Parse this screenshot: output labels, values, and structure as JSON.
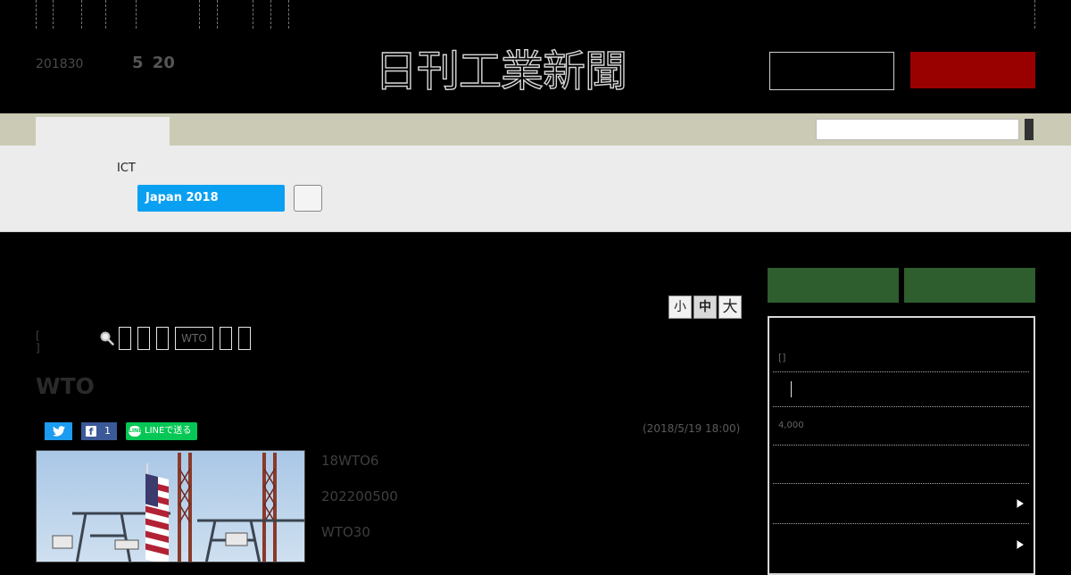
{
  "header": {
    "date": "201830",
    "edition": "5 20",
    "logo_text": "日刊工業新聞"
  },
  "subnav": {
    "category": "ICT",
    "banner_label": "Japan 2018"
  },
  "article": {
    "font_sizes": [
      "小",
      "中",
      "大"
    ],
    "tags": [
      "",
      "",
      "",
      "WTO",
      "",
      ""
    ],
    "title": "WTO",
    "date": "(2018/5/19 18:00)",
    "share": {
      "facebook_count": "1",
      "line_label": "LINEで送る"
    },
    "body_lines": [
      "18WTO6",
      "202200500",
      "WTO30"
    ]
  },
  "sidebar": {
    "bracket": "[]",
    "price": "4,000"
  },
  "colors": {
    "subscribe": "#990000",
    "nav_band": "#cbcab4",
    "banner": "#0aa0f2",
    "sidebar_buttons": "#2e5d2e"
  }
}
